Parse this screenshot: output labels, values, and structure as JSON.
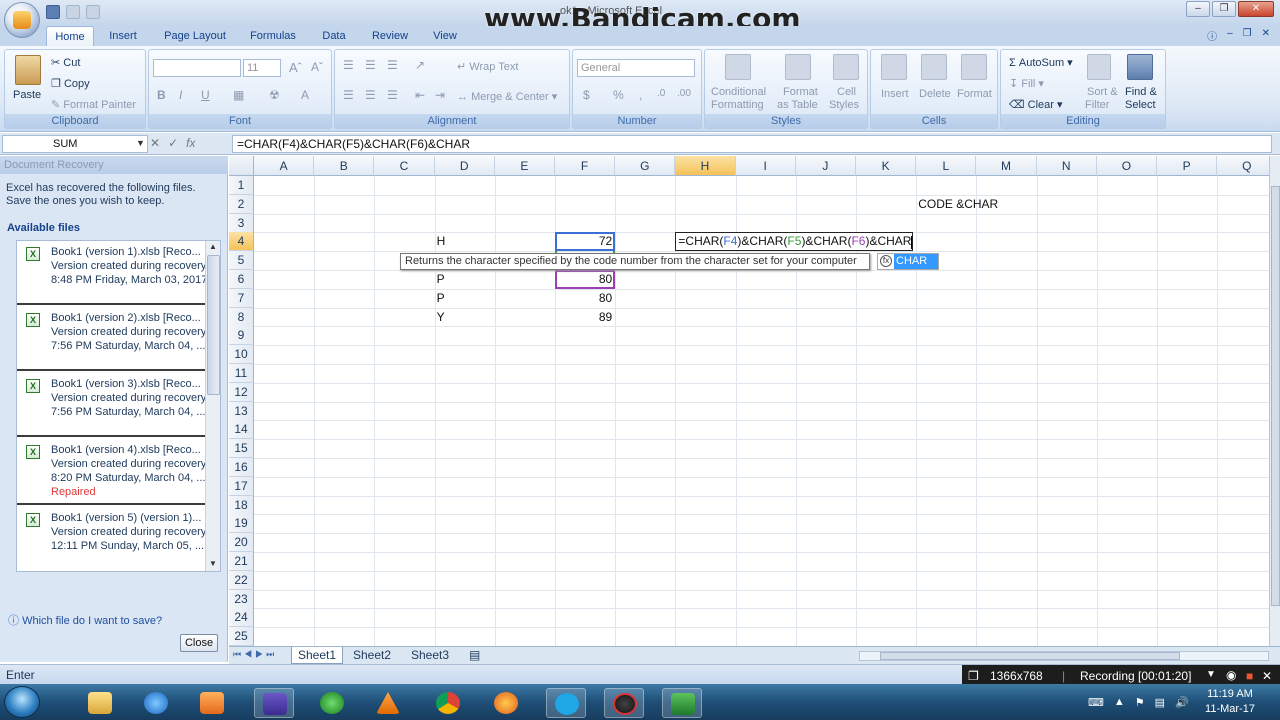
{
  "watermark": "www.Bandicam.com",
  "window_title": "ok1 - Microsoft Excel",
  "ribbon_tabs": [
    "Home",
    "Insert",
    "Page Layout",
    "Formulas",
    "Data",
    "Review",
    "View"
  ],
  "ribbon": {
    "clipboard": {
      "label": "Clipboard",
      "paste": "Paste",
      "cut": "Cut",
      "copy": "Copy",
      "format_painter": "Format Painter"
    },
    "font": {
      "label": "Font",
      "size": "11"
    },
    "alignment": {
      "label": "Alignment",
      "wrap": "Wrap Text",
      "merge": "Merge & Center"
    },
    "number": {
      "label": "Number",
      "format": "General"
    },
    "styles": {
      "label": "Styles",
      "cond": "Conditional",
      "cond2": "Formatting",
      "fmt_table": "Format",
      "fmt_table2": "as Table",
      "cell_styles": "Cell",
      "cell_styles2": "Styles"
    },
    "cells": {
      "label": "Cells",
      "insert": "Insert",
      "delete": "Delete",
      "format": "Format"
    },
    "editing": {
      "label": "Editing",
      "autosum": "AutoSum",
      "fill": "Fill",
      "clear": "Clear",
      "sort": "Sort &",
      "sort2": "Filter",
      "find": "Find &",
      "find2": "Select"
    }
  },
  "formula_bar": {
    "name_box": "SUM",
    "formula": "=CHAR(F4)&CHAR(F5)&CHAR(F6)&CHAR"
  },
  "doc_recovery": {
    "title": "Document Recovery",
    "description": "Excel has recovered the following files.  Save the ones you wish to keep.",
    "available": "Available files",
    "items": [
      {
        "name": "Book1 (version 1).xlsb  [Reco...",
        "line2": "Version created during recovery",
        "line3": "8:48 PM Friday, March 03, 2017",
        "extra": ""
      },
      {
        "name": "Book1 (version 2).xlsb  [Reco...",
        "line2": "Version created during recovery",
        "line3": "7:56 PM Saturday, March 04, ...",
        "extra": ""
      },
      {
        "name": "Book1 (version 3).xlsb  [Reco...",
        "line2": "Version created during recovery",
        "line3": "7:56 PM Saturday, March 04, ...",
        "extra": ""
      },
      {
        "name": "Book1 (version 4).xlsb  [Reco...",
        "line2": "Version created during recovery",
        "line3": "8:20 PM Saturday, March 04, ...",
        "extra": "Repaired"
      },
      {
        "name": "Book1 (version 5) (version 1)...",
        "line2": "Version created during recovery",
        "line3": "12:11 PM Sunday, March 05, ...",
        "extra": ""
      }
    ],
    "help": "Which file do I want to save?",
    "close": "Close"
  },
  "grid": {
    "columns": [
      "A",
      "B",
      "C",
      "D",
      "E",
      "F",
      "G",
      "H",
      "I",
      "J",
      "K",
      "L",
      "M",
      "N",
      "O",
      "P",
      "Q"
    ],
    "rows": [
      "1",
      "2",
      "3",
      "4",
      "5",
      "6",
      "7",
      "8",
      "9",
      "10",
      "11",
      "12",
      "13",
      "14",
      "15",
      "16",
      "17",
      "18",
      "19",
      "20",
      "21",
      "22",
      "23",
      "24",
      "25"
    ],
    "cells": {
      "L2": "CODE &CHAR",
      "D4": "H",
      "F4": "72",
      "D6": "P",
      "F6": "80",
      "D7": "P",
      "F7": "80",
      "D8": "Y",
      "F8": "89",
      "H4_parts": [
        "=CHAR(",
        "F4",
        ")&CHAR(",
        "F5",
        ")&CHAR(",
        "F6",
        ")&CHAR"
      ]
    },
    "tooltip": "Returns the character specified by the code number from the character set for your computer",
    "autocomplete": "CHAR",
    "ref_colors": {
      "F4": "#3b6fd4",
      "F5": "#3a9a3a",
      "F6": "#9b3fb3"
    }
  },
  "sheets": [
    "Sheet1",
    "Sheet2",
    "Sheet3"
  ],
  "status": {
    "mode": "Enter"
  },
  "recording": {
    "resolution": "1366x768",
    "label": "Recording [00:01:20]"
  },
  "clock": {
    "time": "11:19 AM",
    "date": "11-Mar-17"
  }
}
